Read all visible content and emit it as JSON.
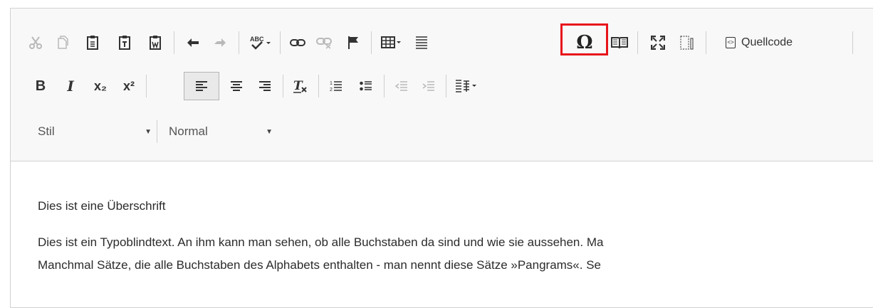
{
  "toolbar": {
    "source_label": "Quellcode",
    "style_combo": {
      "label": "Stil"
    },
    "format_combo": {
      "label": "Normal"
    },
    "subscript_glyph": "x₂",
    "superscript_glyph": "x²",
    "bold_glyph": "B",
    "italic_glyph": "I",
    "omega_glyph": "Ω",
    "highlight_color": "#e8141b"
  },
  "content": {
    "heading": "Dies ist eine Überschrift",
    "line1": "Dies ist ein Typoblindtext. An ihm kann man sehen, ob alle Buchstaben da sind und wie sie aussehen. Ma",
    "line2": "Manchmal Sätze, die alle Buchstaben des Alphabets enthalten - man nennt diese Sätze »Pangrams«. Se"
  }
}
